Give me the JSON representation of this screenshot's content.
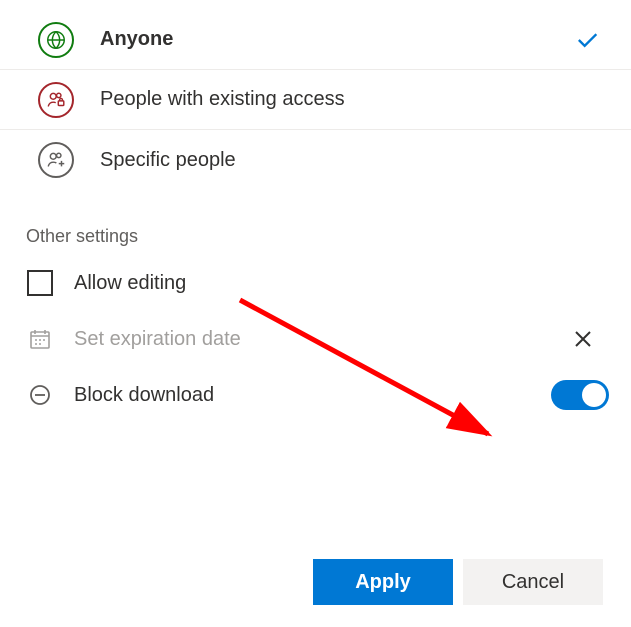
{
  "share_options": {
    "items": [
      {
        "label": "Anyone",
        "icon": "globe",
        "color": "green",
        "selected": true
      },
      {
        "label": "People with existing access",
        "icon": "people-lock",
        "color": "red",
        "selected": false
      },
      {
        "label": "Specific people",
        "icon": "people-plus",
        "color": "gray",
        "selected": false
      }
    ]
  },
  "section_label": "Other settings",
  "settings": {
    "allow_editing": {
      "label": "Allow editing",
      "checked": false
    },
    "expiration": {
      "label": "Set expiration date",
      "set": false
    },
    "block_download": {
      "label": "Block download",
      "enabled": true
    }
  },
  "buttons": {
    "apply": "Apply",
    "cancel": "Cancel"
  },
  "accent_color": "#0078d4"
}
